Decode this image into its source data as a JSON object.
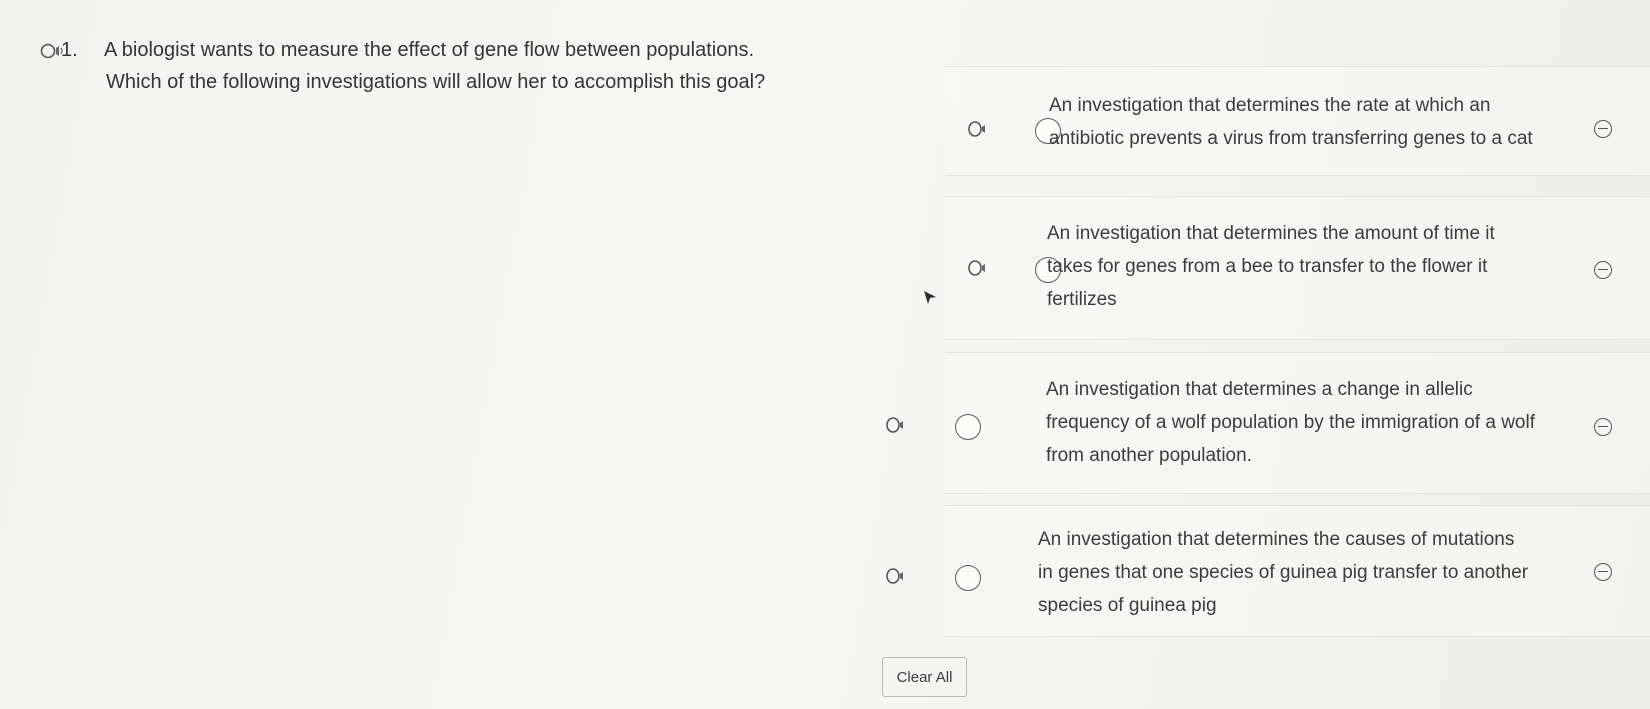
{
  "question": {
    "number": "1.",
    "line1": "A biologist wants to measure the effect of gene flow between populations.",
    "line2": "Which of the following investigations will allow her to accomplish this goal?"
  },
  "options": [
    {
      "lines": [
        "An investigation that determines the rate at which an",
        "antibiotic prevents a virus from transferring genes to a cat"
      ]
    },
    {
      "lines": [
        "An investigation that determines the amount of time it",
        "takes for genes from a bee to transfer to the flower it",
        "fertilizes"
      ]
    },
    {
      "lines": [
        "An investigation that determines a change in allelic",
        "frequency of a wolf population by the immigration of a wolf",
        "from another population."
      ]
    },
    {
      "lines": [
        "An investigation that determines the causes of mutations",
        "in genes that one species of guinea pig transfer to another",
        "species of guinea pig"
      ]
    }
  ],
  "buttons": {
    "clear_all": "Clear All"
  },
  "icons": {
    "text_to_speech": "speaker-icon",
    "answer_choice": "radio-button",
    "eliminate_choice": "minus-circle-icon",
    "mouse_cursor": "arrow-cursor-icon"
  }
}
